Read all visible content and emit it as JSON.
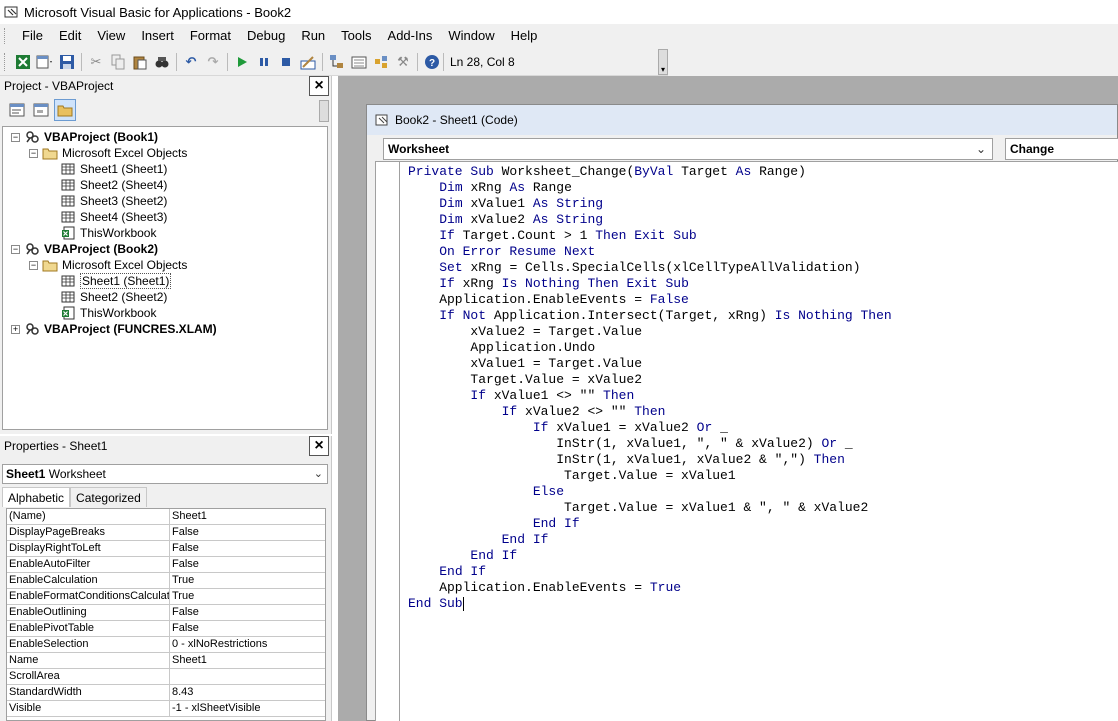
{
  "window": {
    "title": "Microsoft Visual Basic for Applications - Book2"
  },
  "menu": [
    "File",
    "Edit",
    "View",
    "Insert",
    "Format",
    "Debug",
    "Run",
    "Tools",
    "Add-Ins",
    "Window",
    "Help"
  ],
  "toolbar": {
    "position": "Ln 28, Col 8"
  },
  "project": {
    "title": "Project - VBAProject",
    "tree": [
      {
        "label": "VBAProject (Book1)",
        "level": 0,
        "icon": "vba-project-icon",
        "toggle": "−",
        "bold": true
      },
      {
        "label": "Microsoft Excel Objects",
        "level": 1,
        "icon": "folder-icon",
        "toggle": "−"
      },
      {
        "label": "Sheet1 (Sheet1)",
        "level": 2,
        "icon": "sheet-icon"
      },
      {
        "label": "Sheet2 (Sheet4)",
        "level": 2,
        "icon": "sheet-icon"
      },
      {
        "label": "Sheet3 (Sheet2)",
        "level": 2,
        "icon": "sheet-icon"
      },
      {
        "label": "Sheet4 (Sheet3)",
        "level": 2,
        "icon": "sheet-icon"
      },
      {
        "label": "ThisWorkbook",
        "level": 2,
        "icon": "workbook-icon"
      },
      {
        "label": "VBAProject (Book2)",
        "level": 0,
        "icon": "vba-project-icon",
        "toggle": "−",
        "bold": true
      },
      {
        "label": "Microsoft Excel Objects",
        "level": 1,
        "icon": "folder-icon",
        "toggle": "−"
      },
      {
        "label": "Sheet1 (Sheet1)",
        "level": 2,
        "icon": "sheet-icon",
        "selected": true
      },
      {
        "label": "Sheet2 (Sheet2)",
        "level": 2,
        "icon": "sheet-icon"
      },
      {
        "label": "ThisWorkbook",
        "level": 2,
        "icon": "workbook-icon"
      },
      {
        "label": "VBAProject (FUNCRES.XLAM)",
        "level": 0,
        "icon": "vba-project-icon",
        "toggle": "+",
        "bold": true
      }
    ]
  },
  "properties": {
    "title": "Properties - Sheet1",
    "object_name": "Sheet1",
    "object_type": "Worksheet",
    "tabs": [
      "Alphabetic",
      "Categorized"
    ],
    "rows": [
      [
        "(Name)",
        "Sheet1"
      ],
      [
        "DisplayPageBreaks",
        "False"
      ],
      [
        "DisplayRightToLeft",
        "False"
      ],
      [
        "EnableAutoFilter",
        "False"
      ],
      [
        "EnableCalculation",
        "True"
      ],
      [
        "EnableFormatConditionsCalculatio",
        "True"
      ],
      [
        "EnableOutlining",
        "False"
      ],
      [
        "EnablePivotTable",
        "False"
      ],
      [
        "EnableSelection",
        "0 - xlNoRestrictions"
      ],
      [
        "Name",
        "Sheet1"
      ],
      [
        "ScrollArea",
        ""
      ],
      [
        "StandardWidth",
        "8.43"
      ],
      [
        "Visible",
        "-1 - xlSheetVisible"
      ]
    ]
  },
  "code_window": {
    "title": "Book2 - Sheet1 (Code)",
    "object_combo": "Worksheet",
    "proc_combo": "Change",
    "lines": [
      [
        [
          "kw",
          "Private Sub "
        ],
        [
          "t",
          "Worksheet_Change("
        ],
        [
          "kw",
          "ByVal "
        ],
        [
          "t",
          "Target "
        ],
        [
          "kw",
          "As "
        ],
        [
          "t",
          "Range)"
        ]
      ],
      [
        [
          "t",
          "    "
        ],
        [
          "kw",
          "Dim "
        ],
        [
          "t",
          "xRng "
        ],
        [
          "kw",
          "As "
        ],
        [
          "t",
          "Range"
        ]
      ],
      [
        [
          "t",
          "    "
        ],
        [
          "kw",
          "Dim "
        ],
        [
          "t",
          "xValue1 "
        ],
        [
          "kw",
          "As String"
        ]
      ],
      [
        [
          "t",
          "    "
        ],
        [
          "kw",
          "Dim "
        ],
        [
          "t",
          "xValue2 "
        ],
        [
          "kw",
          "As String"
        ]
      ],
      [
        [
          "t",
          "    "
        ],
        [
          "kw",
          "If "
        ],
        [
          "t",
          "Target.Count > 1 "
        ],
        [
          "kw",
          "Then Exit Sub"
        ]
      ],
      [
        [
          "t",
          "    "
        ],
        [
          "kw",
          "On Error Resume Next"
        ]
      ],
      [
        [
          "t",
          "    "
        ],
        [
          "kw",
          "Set "
        ],
        [
          "t",
          "xRng = Cells.SpecialCells(xlCellTypeAllValidation)"
        ]
      ],
      [
        [
          "t",
          "    "
        ],
        [
          "kw",
          "If "
        ],
        [
          "t",
          "xRng "
        ],
        [
          "kw",
          "Is Nothing Then Exit Sub"
        ]
      ],
      [
        [
          "t",
          "    Application.EnableEvents = "
        ],
        [
          "kw",
          "False"
        ]
      ],
      [
        [
          "t",
          "    "
        ],
        [
          "kw",
          "If Not "
        ],
        [
          "t",
          "Application.Intersect(Target, xRng) "
        ],
        [
          "kw",
          "Is Nothing Then"
        ]
      ],
      [
        [
          "t",
          "        xValue2 = Target.Value"
        ]
      ],
      [
        [
          "t",
          "        Application.Undo"
        ]
      ],
      [
        [
          "t",
          "        xValue1 = Target.Value"
        ]
      ],
      [
        [
          "t",
          "        Target.Value = xValue2"
        ]
      ],
      [
        [
          "t",
          "        "
        ],
        [
          "kw",
          "If "
        ],
        [
          "t",
          "xValue1 <> \"\" "
        ],
        [
          "kw",
          "Then"
        ]
      ],
      [
        [
          "t",
          "            "
        ],
        [
          "kw",
          "If "
        ],
        [
          "t",
          "xValue2 <> \"\" "
        ],
        [
          "kw",
          "Then"
        ]
      ],
      [
        [
          "t",
          "                "
        ],
        [
          "kw",
          "If "
        ],
        [
          "t",
          "xValue1 = xValue2 "
        ],
        [
          "kw",
          "Or "
        ],
        [
          "t",
          "_"
        ]
      ],
      [
        [
          "t",
          "                   InStr(1, xValue1, \", \" & xValue2) "
        ],
        [
          "kw",
          "Or "
        ],
        [
          "t",
          "_"
        ]
      ],
      [
        [
          "t",
          "                   InStr(1, xValue1, xValue2 & \",\") "
        ],
        [
          "kw",
          "Then"
        ]
      ],
      [
        [
          "t",
          "                    Target.Value = xValue1"
        ]
      ],
      [
        [
          "t",
          "                "
        ],
        [
          "kw",
          "Else"
        ]
      ],
      [
        [
          "t",
          "                    Target.Value = xValue1 & \", \" & xValue2"
        ]
      ],
      [
        [
          "t",
          "                "
        ],
        [
          "kw",
          "End If"
        ]
      ],
      [
        [
          "t",
          "            "
        ],
        [
          "kw",
          "End If"
        ]
      ],
      [
        [
          "t",
          "        "
        ],
        [
          "kw",
          "End If"
        ]
      ],
      [
        [
          "t",
          "    "
        ],
        [
          "kw",
          "End If"
        ]
      ],
      [
        [
          "t",
          "    Application.EnableEvents = "
        ],
        [
          "kw",
          "True"
        ]
      ],
      [
        [
          "kw",
          "End Sub"
        ]
      ]
    ]
  }
}
